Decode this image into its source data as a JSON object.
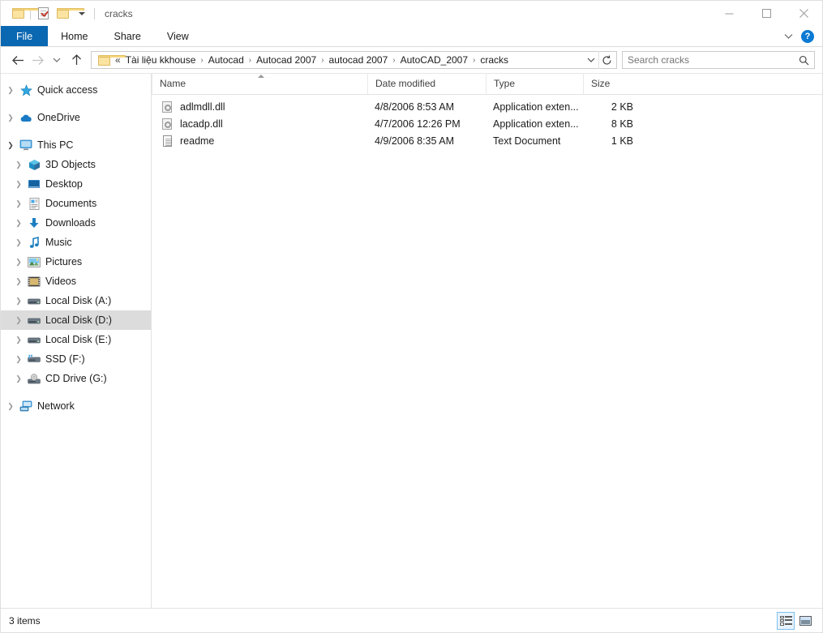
{
  "titlebar": {
    "title": "cracks",
    "quick_access": [
      {
        "name": "folder-icon",
        "label": "Folder"
      },
      {
        "name": "properties-icon",
        "label": "Properties"
      },
      {
        "name": "new-folder-icon",
        "label": "New folder"
      },
      {
        "name": "chevron-down-icon",
        "label": "Customize Quick Access Toolbar"
      }
    ],
    "window_controls": {
      "minimize": "Minimize",
      "maximize": "Maximize",
      "close": "Close"
    }
  },
  "ribbon": {
    "tabs": [
      {
        "label": "File",
        "active": true
      },
      {
        "label": "Home",
        "active": false
      },
      {
        "label": "Share",
        "active": false
      },
      {
        "label": "View",
        "active": false
      }
    ],
    "collapse_label": "Minimize the Ribbon",
    "help_label": "?"
  },
  "addressbar": {
    "back_label": "Back",
    "forward_label": "Forward",
    "recent_label": "Recent locations",
    "up_label": "Up",
    "overflow": "«",
    "crumbs": [
      "Tài liệu kkhouse",
      "Autocad",
      "Autocad 2007",
      "autocad 2007",
      "AutoCAD_2007",
      "cracks"
    ],
    "separator": "›",
    "dropdown_label": "Previous locations",
    "refresh_label": "Refresh"
  },
  "search": {
    "placeholder": "Search cracks",
    "value": ""
  },
  "sidebar": {
    "items": [
      {
        "label": "Quick access",
        "icon": "star-icon",
        "indent": 0,
        "chevron": "collapsed",
        "selected": false
      },
      {
        "label": "OneDrive",
        "icon": "cloud-icon",
        "indent": 0,
        "chevron": "collapsed",
        "selected": false
      },
      {
        "label": "This PC",
        "icon": "monitor-icon",
        "indent": 0,
        "chevron": "expanded",
        "selected": false
      },
      {
        "label": "3D Objects",
        "icon": "cube-icon",
        "indent": 1,
        "chevron": "collapsed",
        "selected": false
      },
      {
        "label": "Desktop",
        "icon": "desktop-icon",
        "indent": 1,
        "chevron": "collapsed",
        "selected": false
      },
      {
        "label": "Documents",
        "icon": "documents-icon",
        "indent": 1,
        "chevron": "collapsed",
        "selected": false
      },
      {
        "label": "Downloads",
        "icon": "download-icon",
        "indent": 1,
        "chevron": "collapsed",
        "selected": false
      },
      {
        "label": "Music",
        "icon": "music-note-icon",
        "indent": 1,
        "chevron": "collapsed",
        "selected": false
      },
      {
        "label": "Pictures",
        "icon": "picture-icon",
        "indent": 1,
        "chevron": "collapsed",
        "selected": false
      },
      {
        "label": "Videos",
        "icon": "video-icon",
        "indent": 1,
        "chevron": "collapsed",
        "selected": false
      },
      {
        "label": "Local Disk (A:)",
        "icon": "drive-icon",
        "indent": 1,
        "chevron": "collapsed",
        "selected": false
      },
      {
        "label": "Local Disk (D:)",
        "icon": "drive-icon",
        "indent": 1,
        "chevron": "collapsed",
        "selected": true
      },
      {
        "label": "Local Disk (E:)",
        "icon": "drive-icon",
        "indent": 1,
        "chevron": "collapsed",
        "selected": false
      },
      {
        "label": "SSD (F:)",
        "icon": "ssd-icon",
        "indent": 1,
        "chevron": "collapsed",
        "selected": false
      },
      {
        "label": "CD Drive (G:)",
        "icon": "cd-drive-icon",
        "indent": 1,
        "chevron": "collapsed",
        "selected": false
      },
      {
        "label": "Network",
        "icon": "network-icon",
        "indent": 0,
        "chevron": "collapsed",
        "selected": false
      }
    ]
  },
  "filelist": {
    "columns": [
      {
        "label": "Name",
        "sorted": "asc"
      },
      {
        "label": "Date modified",
        "sorted": ""
      },
      {
        "label": "Type",
        "sorted": ""
      },
      {
        "label": "Size",
        "sorted": ""
      }
    ],
    "rows": [
      {
        "name": "adlmdll.dll",
        "date": "4/8/2006 8:53 AM",
        "type": "Application exten...",
        "size": "2 KB",
        "icon": "dll-icon"
      },
      {
        "name": "lacadp.dll",
        "date": "4/7/2006 12:26 PM",
        "type": "Application exten...",
        "size": "8 KB",
        "icon": "dll-icon"
      },
      {
        "name": "readme",
        "date": "4/9/2006 8:35 AM",
        "type": "Text Document",
        "size": "1 KB",
        "icon": "text-document-icon"
      }
    ]
  },
  "statusbar": {
    "item_count": "3 items",
    "view_details_label": "Details view",
    "view_thumbnails_label": "Large icons view"
  },
  "colors": {
    "accent": "#0a67b1",
    "help": "#0a7ad4",
    "selection": "#dcdcdc",
    "folder": "#fbe3a1"
  }
}
